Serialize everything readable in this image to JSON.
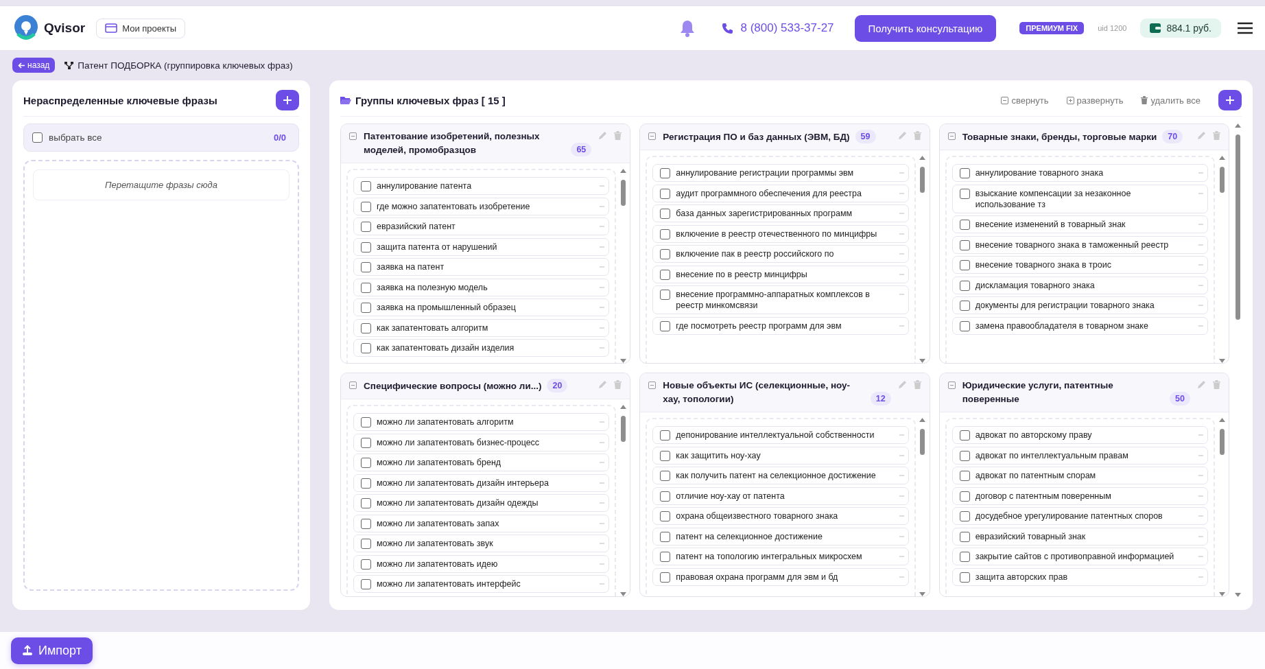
{
  "header": {
    "logo": "Qvisor",
    "projects_button": "Мои проекты",
    "phone": "8 (800) 533-37-27",
    "cta_button": "Получить консультацию",
    "plan_badge": "ПРЕМИУМ FIX",
    "uid": "uid 1200",
    "balance": "884.1 руб."
  },
  "breadcrumb": {
    "back_button": "назад",
    "title": "Патент ПОДБОРКА (группировка ключевых фраз)"
  },
  "unassigned": {
    "title": "Нераспределенные ключевые фразы",
    "select_all": {
      "label": "выбрать все",
      "checked": false
    },
    "counter": "0/0",
    "drop_hint": "Перетащите фразы сюда"
  },
  "groups_panel": {
    "title": "Группы ключевых фраз [ 15 ]",
    "actions": [
      {
        "kind": "collapse",
        "label": "свернуть"
      },
      {
        "kind": "expand",
        "label": "развернуть"
      },
      {
        "kind": "delete",
        "label": "удалить все"
      }
    ]
  },
  "groups": [
    {
      "title": "Патентование изобретений, полезных моделей, промобразцов",
      "count": "65",
      "expanded": true,
      "phrases": [
        {
          "text": "аннулирование патента",
          "checked": false
        },
        {
          "text": "где можно запатентовать изобретение",
          "checked": false
        },
        {
          "text": "евразийский патент",
          "checked": false
        },
        {
          "text": "защита патента от нарушений",
          "checked": false
        },
        {
          "text": "заявка на патент",
          "checked": false
        },
        {
          "text": "заявка на полезную модель",
          "checked": false
        },
        {
          "text": "заявка на промышленный образец",
          "checked": false
        },
        {
          "text": "как запатентовать алгоритм",
          "checked": false
        },
        {
          "text": "как запатентовать дизайн изделия",
          "checked": false
        }
      ]
    },
    {
      "title": "Регистрация ПО и баз данных (ЭВМ, БД)",
      "count": "59",
      "expanded": true,
      "phrases": [
        {
          "text": "аннулирование регистрации программы эвм",
          "checked": false
        },
        {
          "text": "аудит программного обеспечения для реестра",
          "checked": false
        },
        {
          "text": "база данных зарегистрированных программ",
          "checked": false
        },
        {
          "text": "включение в реестр отечественного по минцифры",
          "checked": false
        },
        {
          "text": "включение пак в реестр российского по",
          "checked": false
        },
        {
          "text": "внесение по в реестр минцифры",
          "checked": false
        },
        {
          "text": "внесение программно-аппаратных комплексов в реестр минкомсвязи",
          "checked": false
        },
        {
          "text": "где посмотреть реестр программ для эвм",
          "checked": false
        }
      ]
    },
    {
      "title": "Товарные знаки, бренды, торговые марки",
      "count": "70",
      "expanded": true,
      "phrases": [
        {
          "text": "аннулирование товарного знака",
          "checked": false
        },
        {
          "text": "взыскание компенсации за незаконное использование тз",
          "checked": false
        },
        {
          "text": "внесение изменений в товарный знак",
          "checked": false
        },
        {
          "text": "внесение товарного знака в таможенный реестр",
          "checked": false
        },
        {
          "text": "внесение товарного знака в троис",
          "checked": false
        },
        {
          "text": "дискламация товарного знака",
          "checked": false
        },
        {
          "text": "документы для регистрации товарного знака",
          "checked": false
        },
        {
          "text": "замена правообладателя в товарном знаке",
          "checked": false
        }
      ]
    },
    {
      "title": "Специфические вопросы (можно ли...)",
      "count": "20",
      "expanded": true,
      "phrases": [
        {
          "text": "можно ли запатентовать алгоритм",
          "checked": false
        },
        {
          "text": "можно ли запатентовать бизнес-процесс",
          "checked": false
        },
        {
          "text": "можно ли запатентовать бренд",
          "checked": false
        },
        {
          "text": "можно ли запатентовать дизайн интерьера",
          "checked": false
        },
        {
          "text": "можно ли запатентовать дизайн одежды",
          "checked": false
        },
        {
          "text": "можно ли запатентовать запах",
          "checked": false
        },
        {
          "text": "можно ли запатентовать звук",
          "checked": false
        },
        {
          "text": "можно ли запатентовать идею",
          "checked": false
        },
        {
          "text": "можно ли запатентовать интерфейс",
          "checked": false
        }
      ]
    },
    {
      "title": "Новые объекты ИС (селекционные, ноу-хау, топологии)",
      "count": "12",
      "expanded": true,
      "phrases": [
        {
          "text": "депонирование интеллектуальной собственности",
          "checked": false
        },
        {
          "text": "как защитить ноу-хау",
          "checked": false
        },
        {
          "text": "как получить патент на селекционное достижение",
          "checked": false
        },
        {
          "text": "отличие ноу-хау от патента",
          "checked": false
        },
        {
          "text": "охрана общеизвестного товарного знака",
          "checked": false
        },
        {
          "text": "патент на селекционное достижение",
          "checked": false
        },
        {
          "text": "патент на топологию интегральных микросхем",
          "checked": false
        },
        {
          "text": "правовая охрана программ для эвм и бд",
          "checked": false
        }
      ]
    },
    {
      "title": "Юридические услуги, патентные поверенные",
      "count": "50",
      "expanded": true,
      "phrases": [
        {
          "text": "адвокат по авторскому праву",
          "checked": false
        },
        {
          "text": "адвокат по интеллектуальным правам",
          "checked": false
        },
        {
          "text": "адвокат по патентным спорам",
          "checked": false
        },
        {
          "text": "договор с патентным поверенным",
          "checked": false
        },
        {
          "text": "досудебное урегулирование патентных споров",
          "checked": false
        },
        {
          "text": "евразийский товарный знак",
          "checked": false
        },
        {
          "text": "закрытие сайтов с противоправной информацией",
          "checked": false
        },
        {
          "text": "защита авторских прав",
          "checked": false
        }
      ]
    }
  ],
  "import_button": "Импорт"
}
